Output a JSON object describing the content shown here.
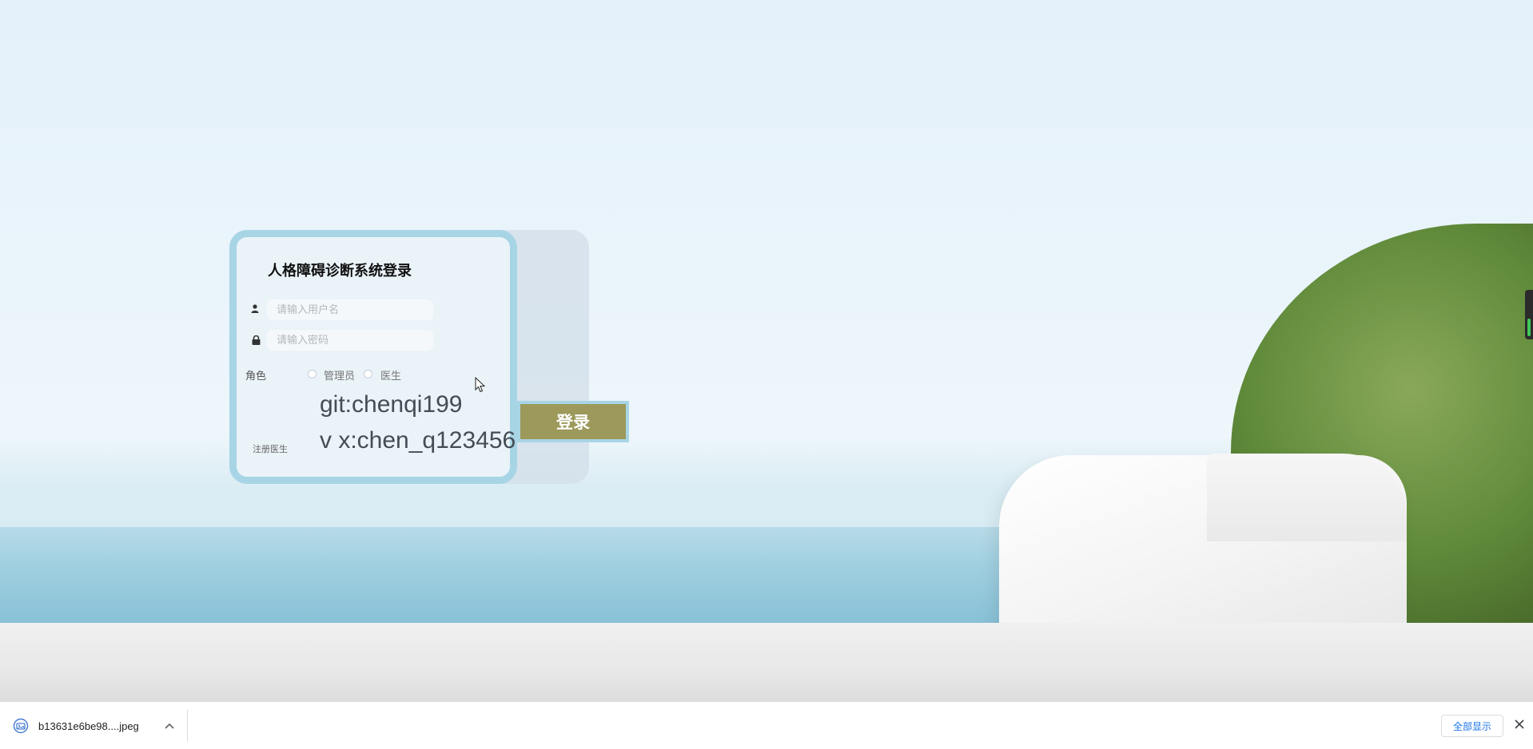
{
  "login": {
    "title": "人格障碍诊断系统登录",
    "username_placeholder": "请输入用户名",
    "password_placeholder": "请输入密码",
    "role_label": "角色",
    "roles": [
      "管理员",
      "医生"
    ],
    "watermark_line1": "git:chenqi199",
    "watermark_line2": "v x:chen_q123456",
    "register_link": "注册医生",
    "submit_label": "登录"
  },
  "colors": {
    "card_border": "#a8d5e6",
    "login_button": "#9c995b"
  },
  "download_bar": {
    "file_name": "b13631e6be98....jpeg",
    "show_all_label": "全部显示",
    "icons": [
      "image-file-icon",
      "chevron-up-icon",
      "close-icon"
    ]
  }
}
